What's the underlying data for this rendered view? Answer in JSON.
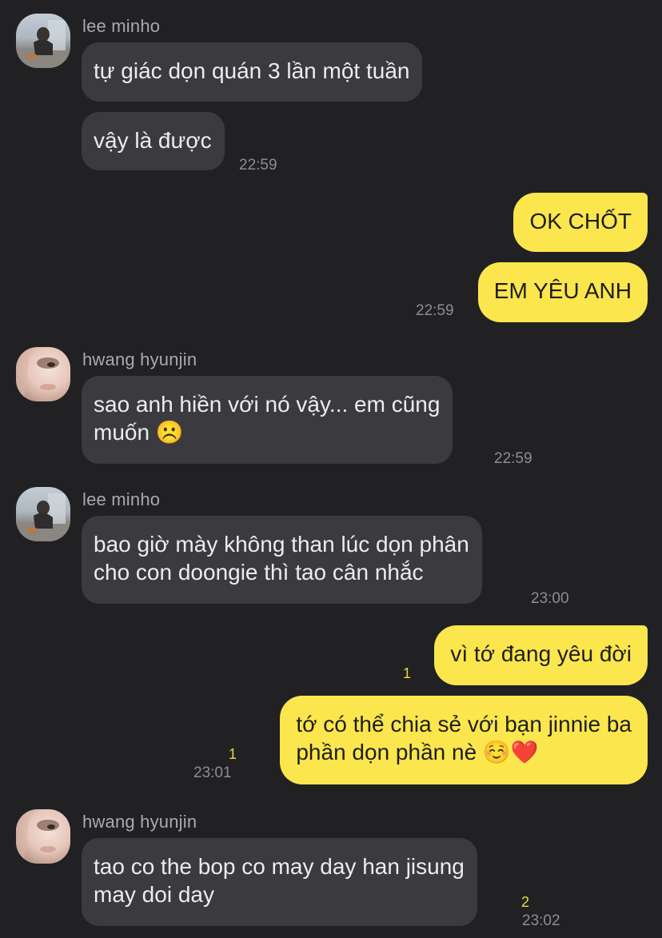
{
  "chat": {
    "messages": [
      {
        "sender": "lee minho",
        "text": "tự giác dọn quán 3 lần một tuần"
      },
      {
        "text": "vậy là được",
        "time": "22:59"
      },
      {
        "direction": "out",
        "text": "OK CHỐT"
      },
      {
        "direction": "out",
        "text": "EM YÊU ANH",
        "time": "22:59"
      },
      {
        "sender": "hwang hyunjin",
        "text": "sao anh hiền với nó vậy... em cũng\nmuốn ☹️",
        "time": "22:59"
      },
      {
        "sender": "lee minho",
        "text": "bao giờ mày không than lúc dọn phân\ncho con doongie thì tao cân nhắc",
        "time": "23:00"
      },
      {
        "direction": "out",
        "text": "vì tớ đang yêu đời",
        "unread": "1"
      },
      {
        "direction": "out",
        "text": "tớ có thể chia sẻ với bạn jinnie ba\nphần dọn phần nè ☺️❤️",
        "unread": "1",
        "time": "23:01"
      },
      {
        "sender": "hwang hyunjin",
        "text": "tao co the bop co may day han jisung\nmay doi day",
        "unread": "2",
        "time": "23:02"
      }
    ]
  },
  "colors": {
    "background": "#212124",
    "incoming_bubble": "#3b3b3f",
    "outgoing_bubble": "#fbe64d",
    "unread_count": "#e9d84a"
  }
}
